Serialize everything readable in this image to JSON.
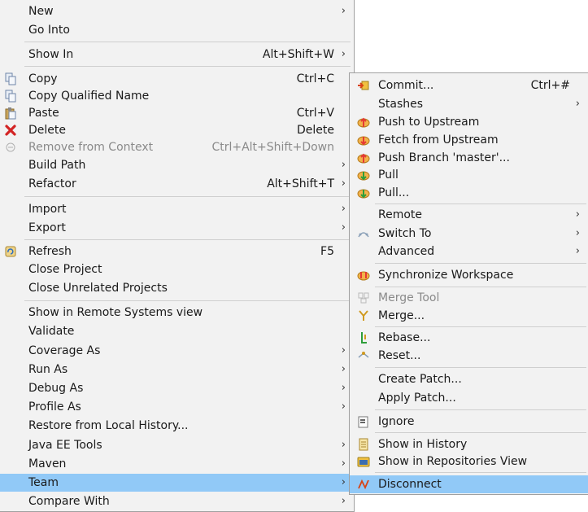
{
  "main_menu": {
    "new": "New",
    "go_into": "Go Into",
    "show_in": "Show In",
    "show_in_accel": "Alt+Shift+W",
    "copy": "Copy",
    "copy_accel": "Ctrl+C",
    "copy_qualified_name": "Copy Qualified Name",
    "paste": "Paste",
    "paste_accel": "Ctrl+V",
    "delete": "Delete",
    "delete_accel": "Delete",
    "remove_from_context": "Remove from Context",
    "remove_from_context_accel": "Ctrl+Alt+Shift+Down",
    "build_path": "Build Path",
    "refactor": "Refactor",
    "refactor_accel": "Alt+Shift+T",
    "import": "Import",
    "export": "Export",
    "refresh": "Refresh",
    "refresh_accel": "F5",
    "close_project": "Close Project",
    "close_unrelated_projects": "Close Unrelated Projects",
    "show_in_remote_systems": "Show in Remote Systems view",
    "validate": "Validate",
    "coverage_as": "Coverage As",
    "run_as": "Run As",
    "debug_as": "Debug As",
    "profile_as": "Profile As",
    "restore_from_local_history": "Restore from Local History...",
    "java_ee_tools": "Java EE Tools",
    "maven": "Maven",
    "team": "Team",
    "compare_with": "Compare With"
  },
  "team_menu": {
    "commit": "Commit...",
    "commit_accel": "Ctrl+#",
    "stashes": "Stashes",
    "push_to_upstream": "Push to Upstream",
    "fetch_from_upstream": "Fetch from Upstream",
    "push_branch": "Push Branch 'master'...",
    "pull": "Pull",
    "pull_dialog": "Pull...",
    "remote": "Remote",
    "switch_to": "Switch To",
    "advanced": "Advanced",
    "synchronize_workspace": "Synchronize Workspace",
    "merge_tool": "Merge Tool",
    "merge": "Merge...",
    "rebase": "Rebase...",
    "reset": "Reset...",
    "create_patch": "Create Patch...",
    "apply_patch": "Apply Patch...",
    "ignore": "Ignore",
    "show_in_history": "Show in History",
    "show_in_repositories_view": "Show in Repositories View",
    "disconnect": "Disconnect"
  },
  "symbols": {
    "submenu_arrow": "›"
  },
  "colors": {
    "menu_bg": "#f2f2f2",
    "highlight": "#91c9f7",
    "disabled_text": "#8a8a8a"
  }
}
